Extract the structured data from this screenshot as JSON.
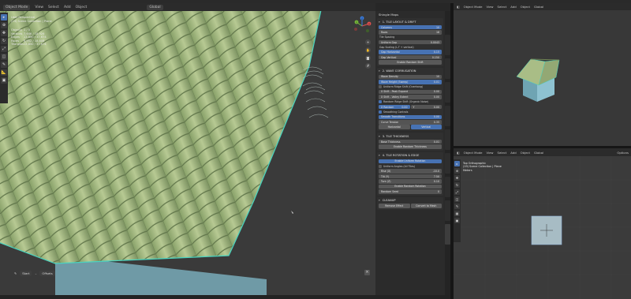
{
  "viewport": {
    "header": {
      "mode": "Object Mode",
      "menus": [
        "View",
        "Select",
        "Add",
        "Object"
      ],
      "transform": "Global"
    },
    "view_name": "User Perspective",
    "collection": "(19) Scene Collection | Plane",
    "stats": [
      {
        "label": "Objects",
        "value": "1 / 5"
      },
      {
        "label": "Vertices",
        "value": "7,646 / 18,926"
      },
      {
        "label": "Edges",
        "value": "13,850 / 37,674"
      },
      {
        "label": "Faces",
        "value": "6,952 / 18,808"
      },
      {
        "label": "Triangles",
        "value": "13,850 / 37,674"
      }
    ],
    "tools": [
      "select",
      "cursor",
      "move",
      "rotate",
      "scale",
      "transform",
      "annotate",
      "measure",
      "add"
    ],
    "gizmo": {
      "x": "X",
      "y": "Y",
      "z": "Z"
    },
    "footer": {
      "item1": "Start",
      "item2": "Offsets"
    },
    "colors": {
      "tile": "#a9bd86",
      "tile_dark": "#7e9463",
      "edge": "#48d4c0",
      "bg": "#3a3a3a"
    }
  },
  "panel": {
    "title": "Shingle Maps",
    "sections": {
      "layout": {
        "title": "1. TILE LAYOUT & DRIFT",
        "rows": [
          {
            "label": "Columns",
            "value": "10"
          },
          {
            "label": "Rows",
            "value": "18"
          }
        ],
        "spacing_title": "Tile Spacing",
        "uniform_gap": {
          "label": "Uniform Gap",
          "value": "0.0043"
        },
        "gap_scaling_title": "Gap Scaling (L-T + vertical)",
        "gap_scaling": [
          {
            "label": "Gap Horizontal",
            "value": "0.15"
          },
          {
            "label": "Gap Vertical",
            "value": "0.150"
          }
        ],
        "random_button": "Enable Random Shift"
      },
      "wave": {
        "title": "2. WAVE CORRUGATION",
        "rows": [
          {
            "label": "Wave Density",
            "value": "10"
          },
          {
            "label": "Wave Height (Sweep)",
            "value": "0.01"
          }
        ],
        "ridge_title": "Uniform Ridge Shift (Overhang)",
        "ridge_rows": [
          {
            "label": "X Shift - Peak Expand",
            "value": "0.00"
          },
          {
            "label": "X Shift - Valley Extent",
            "value": "0.00"
          }
        ],
        "random_ridge_title": "Random Ridge Shift (Organic Noise)",
        "random_ridge_pair": [
          {
            "label": "X Random",
            "value": "0.00"
          },
          {
            "label": "Y",
            "value": "0.00"
          }
        ],
        "smoothing_title": "Smoothing Controls",
        "smoothing_rows": [
          {
            "label": "Smooth Transitions",
            "value": "0.00"
          },
          {
            "label": "Curve Tension",
            "value": "0.35"
          }
        ],
        "tabs": [
          "Horizontal",
          "Vertical"
        ]
      },
      "thickness": {
        "title": "3. TILE THICKNESS",
        "rows": [
          {
            "label": "Base Thickness",
            "value": "0.01"
          }
        ],
        "random_button": "Enable Random Thickness"
      },
      "rotation": {
        "title": "4. TILE ROTATION & EDGE",
        "enable_button": "Enable Uniform Rotation",
        "uniform_title": "Uniform Angles (All Tiles)",
        "rows": [
          {
            "label": "Rise (X)",
            "value": "-10.0"
          },
          {
            "label": "Tilt (Y)",
            "value": "7.50"
          },
          {
            "label": "Turn (Z)",
            "value": "0.10"
          }
        ],
        "random_button": "Enable Random Rotation",
        "random_seed": {
          "label": "Random Seed",
          "value": "0"
        }
      },
      "cleanup": {
        "title": "CLEANUP",
        "buttons": [
          "Remove Effect",
          "Convert to Mesh"
        ]
      }
    }
  },
  "top_right": {
    "header": {
      "mode": "Object Mode",
      "menus": [
        "View",
        "Select",
        "Add",
        "Object"
      ],
      "transform": "Global",
      "options": "Options"
    },
    "colors": {
      "house": "#7fb4c4",
      "roof": "#a9bd86"
    }
  },
  "bottom_right": {
    "header": {
      "mode": "Object Mode",
      "menus": [
        "View",
        "Select",
        "Add",
        "Object"
      ],
      "transform": "Global",
      "options": "Options"
    },
    "view_name": "Top Orthographic",
    "collection": "(19) Scene Collection | Plane",
    "units": "Meters"
  }
}
